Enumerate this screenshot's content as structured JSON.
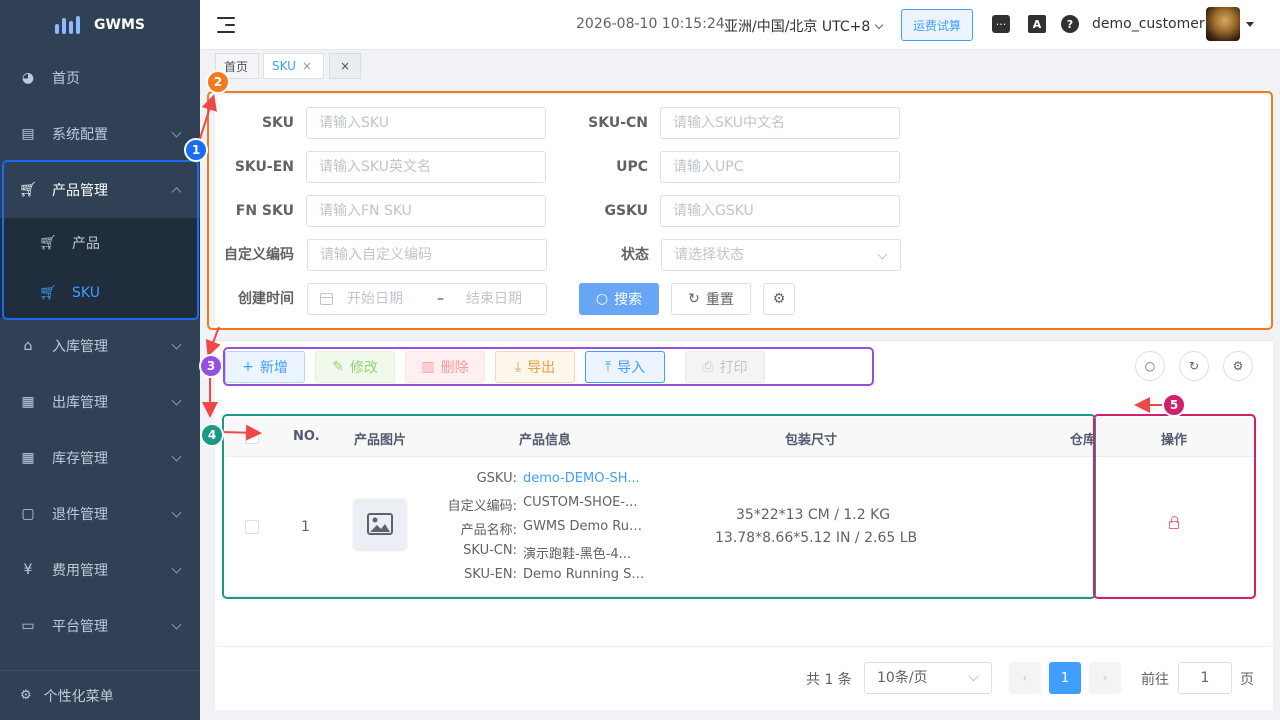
{
  "app": {
    "logo_text": "GWMS"
  },
  "sidebar": {
    "items": [
      {
        "label": "首页"
      },
      {
        "label": "系统配置"
      },
      {
        "label": "产品管理"
      },
      {
        "label": "产品"
      },
      {
        "label": "SKU"
      },
      {
        "label": "入库管理"
      },
      {
        "label": "出库管理"
      },
      {
        "label": "库存管理"
      },
      {
        "label": "退件管理"
      },
      {
        "label": "费用管理"
      },
      {
        "label": "平台管理"
      }
    ],
    "bottom_label": "个性化菜单"
  },
  "header": {
    "datetime": "2026-08-10 10:15:24",
    "timezone": "亚洲/中国/北京 UTC+8",
    "freight_button": "运费试算",
    "lang_icon_text": "A",
    "help_icon_text": "?",
    "username": "demo_customer"
  },
  "tags": [
    {
      "label": "首页"
    },
    {
      "label": "SKU"
    },
    {
      "close": "×"
    }
  ],
  "search": {
    "fields": {
      "sku": {
        "label": "SKU",
        "placeholder": "请输入SKU"
      },
      "sku_cn": {
        "label": "SKU-CN",
        "placeholder": "请输入SKU中文名"
      },
      "sku_en": {
        "label": "SKU-EN",
        "placeholder": "请输入SKU英文名"
      },
      "upc": {
        "label": "UPC",
        "placeholder": "请输入UPC"
      },
      "fn_sku": {
        "label": "FN SKU",
        "placeholder": "请输入FN SKU"
      },
      "gsku": {
        "label": "GSKU",
        "placeholder": "请输入GSKU"
      },
      "custom_code": {
        "label": "自定义编码",
        "placeholder": "请输入自定义编码"
      },
      "status": {
        "label": "状态",
        "placeholder": "请选择状态"
      },
      "created": {
        "label": "创建时间",
        "start": "开始日期",
        "sep": "–",
        "end": "结束日期"
      }
    },
    "search_button": "搜索",
    "reset_button": "重置"
  },
  "toolbar": {
    "add": "新增",
    "edit": "修改",
    "delete": "删除",
    "export": "导出",
    "import": "导入",
    "print": "打印"
  },
  "table": {
    "columns": [
      "NO.",
      "产品图片",
      "产品信息",
      "包装尺寸",
      "仓库",
      "操作"
    ],
    "rows": [
      {
        "no": "1",
        "info": [
          {
            "k": "GSKU:",
            "v": "demo-DEMO-SH..."
          },
          {
            "k": "自定义编码:",
            "v": "CUSTOM-SHOE-..."
          },
          {
            "k": "产品名称:",
            "v": "GWMS Demo Run..."
          },
          {
            "k": "SKU-CN:",
            "v": "演示跑鞋-黑色-4..."
          },
          {
            "k": "SKU-EN:",
            "v": "Demo Running Sh..."
          }
        ],
        "size_metric": "35*22*13 CM / 1.2 KG",
        "size_imperial": "13.78*8.66*5.12 IN / 2.65 LB"
      }
    ]
  },
  "pagination": {
    "total": "共 1 条",
    "page_size": "10条/页",
    "current": "1",
    "goto_label": "前往",
    "goto_value": "1",
    "page_suffix": "页"
  },
  "annotations": [
    "1",
    "2",
    "3",
    "4",
    "5"
  ]
}
